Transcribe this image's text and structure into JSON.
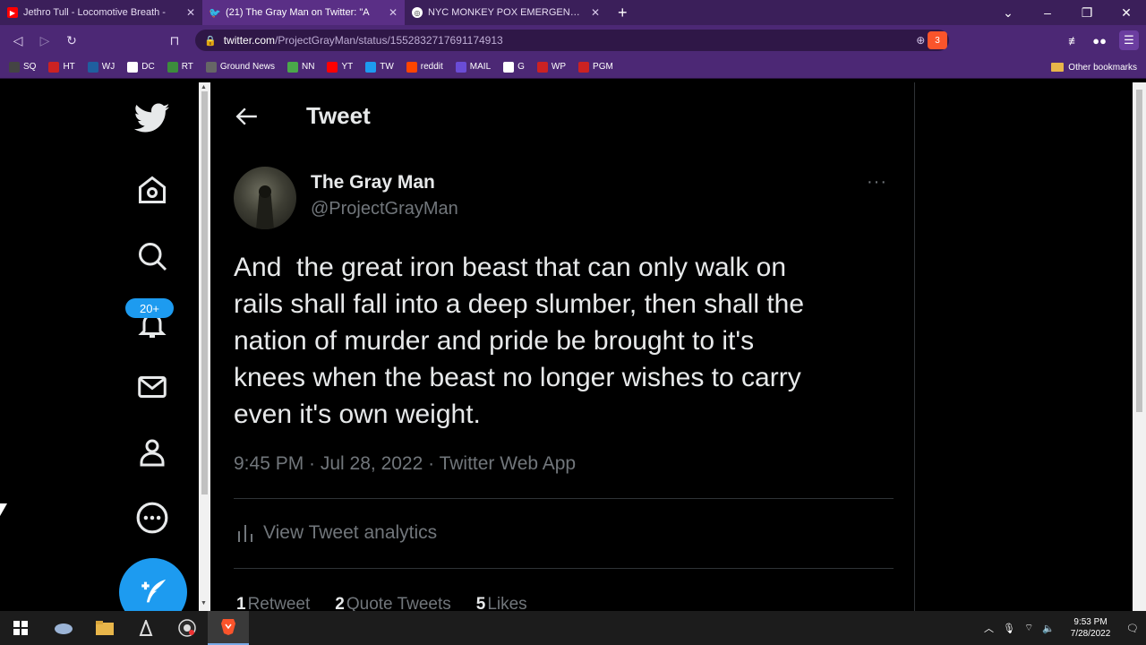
{
  "browser": {
    "tabs": [
      {
        "label": "Jethro Tull - Locomotive Breath -",
        "icon": "youtube-icon",
        "color": "#ff0000",
        "active": false
      },
      {
        "label": "(21) The Gray Man on Twitter: \"A",
        "icon": "twitter-icon",
        "color": "#1d9bf0",
        "active": true
      },
      {
        "label": "NYC MONKEY POX EMERGENCY - Go",
        "icon": "globe-icon",
        "color": "#888888",
        "active": false
      }
    ],
    "new_tab": "+",
    "url_host": "twitter.com",
    "url_path": "/ProjectGrayMan/status/1552832717691174913",
    "shield_count": "3",
    "bookmarks": [
      {
        "label": "SQ",
        "color": "#444444"
      },
      {
        "label": "HT",
        "color": "#cc2222"
      },
      {
        "label": "WJ",
        "color": "#1f5f9f"
      },
      {
        "label": "DC",
        "color": "#ffffff"
      },
      {
        "label": "RT",
        "color": "#3c8c3c"
      },
      {
        "label": "Ground News",
        "color": "#666666"
      },
      {
        "label": "NN",
        "color": "#4aa84a"
      },
      {
        "label": "YT",
        "color": "#ff0000"
      },
      {
        "label": "TW",
        "color": "#1d9bf0"
      },
      {
        "label": "reddit",
        "color": "#ff4500"
      },
      {
        "label": "MAIL",
        "color": "#6a4cd6"
      },
      {
        "label": "G",
        "color": "#ffffff"
      },
      {
        "label": "WP",
        "color": "#cc2222"
      },
      {
        "label": "PGM",
        "color": "#cc2222"
      }
    ],
    "other_bookmarks": "Other bookmarks"
  },
  "sidebar": {
    "notifications_badge": "20+"
  },
  "tweet": {
    "header_title": "Tweet",
    "author_name": "The Gray Man",
    "author_handle": "@ProjectGrayMan",
    "more": "···",
    "text": "And  the great iron beast that can only walk on\nrails shall fall into a deep slumber, then shall the\nnation of murder and pride be brought to it's\nknees when the beast no longer wishes to carry\neven it's own weight.",
    "meta": "9:45 PM · Jul 28, 2022 · Twitter Web App",
    "analytics_label": "View Tweet analytics",
    "stats": {
      "retweets_count": "1",
      "retweets_label": "Retweet",
      "quotes_count": "2",
      "quotes_label": "Quote Tweets",
      "likes_count": "5",
      "likes_label": "Likes"
    }
  },
  "taskbar": {
    "time": "9:53 PM",
    "date": "7/28/2022"
  },
  "colors": {
    "accent": "#1d9bf0",
    "text": "#e7e9ea",
    "muted": "#71767b",
    "browser_chrome": "#4c2875"
  }
}
